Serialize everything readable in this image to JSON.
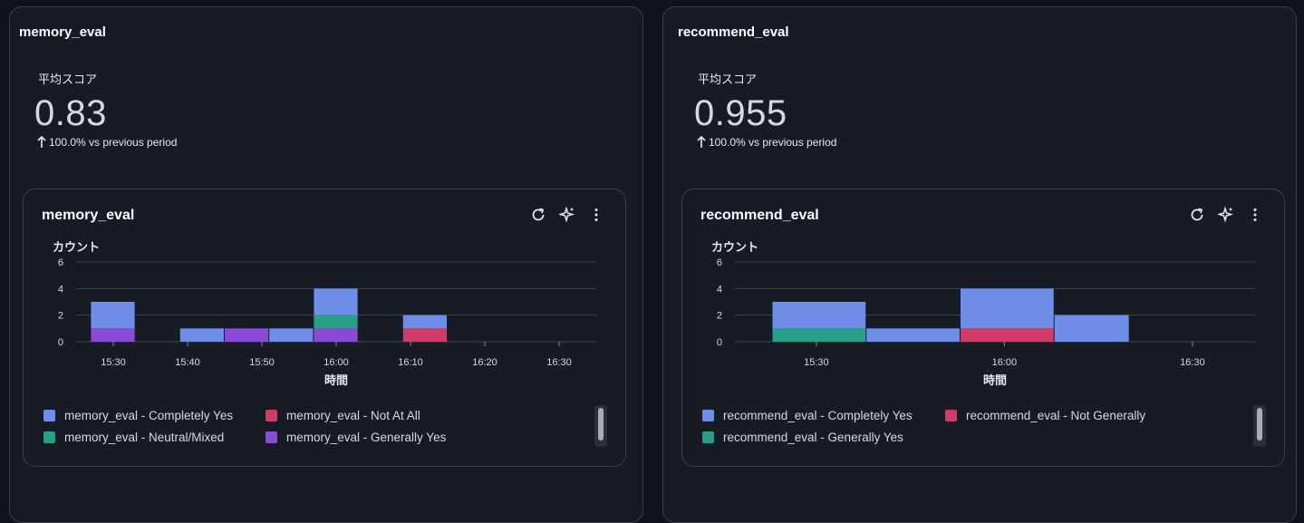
{
  "panels": [
    {
      "title": "memory_eval",
      "metric_label": "平均スコア",
      "metric_value": "0.83",
      "metric_change": "100.0% vs previous period",
      "widget": {
        "title": "memory_eval",
        "actions": [
          "refresh-icon",
          "sparkle-icon",
          "more-vertical-icon"
        ],
        "legend": [
          {
            "name": "memory_eval - Completely Yes",
            "color": "#6e8ee8"
          },
          {
            "name": "memory_eval - Not At All",
            "color": "#cf3d66"
          },
          {
            "name": "memory_eval - Neutral/Mixed",
            "color": "#2aa08a"
          },
          {
            "name": "memory_eval - Generally Yes",
            "color": "#8a4bd6"
          }
        ]
      }
    },
    {
      "title": "recommend_eval",
      "metric_label": "平均スコア",
      "metric_value": "0.955",
      "metric_change": "100.0% vs previous period",
      "widget": {
        "title": "recommend_eval",
        "actions": [
          "refresh-icon",
          "sparkle-icon",
          "more-vertical-icon"
        ],
        "legend": [
          {
            "name": "recommend_eval - Completely Yes",
            "color": "#6e8ee8"
          },
          {
            "name": "recommend_eval - Not Generally",
            "color": "#cf3d66"
          },
          {
            "name": "recommend_eval - Generally Yes",
            "color": "#2aa08a"
          }
        ]
      }
    }
  ],
  "chart_data": [
    {
      "type": "bar",
      "stacked": true,
      "title": "memory_eval",
      "ylabel": "カウント",
      "xlabel": "時間",
      "ylim": [
        0,
        6
      ],
      "yticks": [
        0,
        2,
        4,
        6
      ],
      "x_domain": [
        "15:25",
        "16:35"
      ],
      "xticks": [
        "15:30",
        "15:40",
        "15:50",
        "16:00",
        "16:10",
        "16:20",
        "16:30"
      ],
      "grid": true,
      "legend_position": "bottom",
      "bins": [
        {
          "start": "15:27",
          "end": "15:33",
          "stack": [
            {
              "series": "memory_eval - Generally Yes",
              "value": 1
            },
            {
              "series": "memory_eval - Completely Yes",
              "value": 2
            }
          ]
        },
        {
          "start": "15:39",
          "end": "15:45",
          "stack": [
            {
              "series": "memory_eval - Completely Yes",
              "value": 1
            }
          ]
        },
        {
          "start": "15:45",
          "end": "15:51",
          "stack": [
            {
              "series": "memory_eval - Generally Yes",
              "value": 1
            }
          ]
        },
        {
          "start": "15:51",
          "end": "15:57",
          "stack": [
            {
              "series": "memory_eval - Completely Yes",
              "value": 1
            }
          ]
        },
        {
          "start": "15:57",
          "end": "16:03",
          "stack": [
            {
              "series": "memory_eval - Generally Yes",
              "value": 1
            },
            {
              "series": "memory_eval - Neutral/Mixed",
              "value": 1
            },
            {
              "series": "memory_eval - Completely Yes",
              "value": 2
            }
          ]
        },
        {
          "start": "16:09",
          "end": "16:15",
          "stack": [
            {
              "series": "memory_eval - Not At All",
              "value": 1
            },
            {
              "series": "memory_eval - Completely Yes",
              "value": 1
            }
          ]
        }
      ]
    },
    {
      "type": "bar",
      "stacked": true,
      "title": "recommend_eval",
      "ylabel": "カウント",
      "xlabel": "時間",
      "ylim": [
        0,
        6
      ],
      "yticks": [
        0,
        2,
        4,
        6
      ],
      "x_domain": [
        "15:17",
        "16:40"
      ],
      "xticks": [
        "15:30",
        "16:00",
        "16:30"
      ],
      "grid": true,
      "legend_position": "bottom",
      "bins": [
        {
          "start": "15:23",
          "end": "15:38",
          "stack": [
            {
              "series": "recommend_eval - Generally Yes",
              "value": 1
            },
            {
              "series": "recommend_eval - Completely Yes",
              "value": 2
            }
          ]
        },
        {
          "start": "15:38",
          "end": "15:53",
          "stack": [
            {
              "series": "recommend_eval - Completely Yes",
              "value": 1
            }
          ]
        },
        {
          "start": "15:53",
          "end": "16:08",
          "stack": [
            {
              "series": "recommend_eval - Not Generally",
              "value": 1
            },
            {
              "series": "recommend_eval - Completely Yes",
              "value": 3
            }
          ]
        },
        {
          "start": "16:08",
          "end": "16:20",
          "stack": [
            {
              "series": "recommend_eval - Completely Yes",
              "value": 2
            }
          ]
        }
      ]
    }
  ]
}
